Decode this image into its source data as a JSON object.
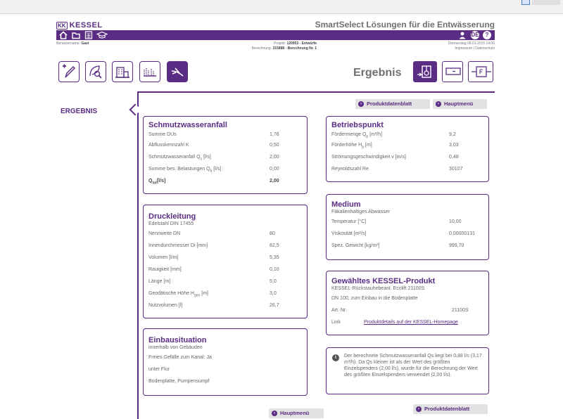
{
  "header": {
    "logo_mark": "KK",
    "logo_text": "KESSEL",
    "site_title": "SmartSelect Lösungen für die Entwässerung",
    "lang_badge": "DE",
    "help_badge": "?"
  },
  "meta": {
    "user_label": "Benutzername:",
    "user_name": "Gast",
    "project_label": "Projekt:",
    "project_value": "120953 - Entwürfe",
    "calc_label": "Berechnung:",
    "calc_value": "315888 - Berechnung Nr. 1",
    "date": "Donnerstag 08.01.2015 14:00",
    "impressum": "Impressum",
    "sep": "|",
    "datenschutz": "Datenschutz"
  },
  "page": {
    "title": "Ergebnis",
    "sidebar_label": "ERGEBNIS"
  },
  "buttons": {
    "produktdatenblatt": "Produktdatenblatt",
    "hauptmenu": "Hauptmenü"
  },
  "schmutzwasser": {
    "title": "Schmutzwasseranfall",
    "rows": [
      {
        "label": "Summe DUs",
        "value": "1,76"
      },
      {
        "label": "Abflusskennzahl K",
        "value": "0,50"
      },
      {
        "label": "Schmutzwasseranfall Q",
        "sub": "s",
        "unit": " [l/s]",
        "value": "2,00"
      },
      {
        "label": "Summe bes. Belastungen Q",
        "sub": "b",
        "unit": " [l/s]",
        "value": "0,00"
      },
      {
        "label": "Q",
        "sub": "tot",
        "unit": "[l/s]",
        "value": "2,00"
      }
    ]
  },
  "druckleitung": {
    "title": "Druckleitung",
    "subtitle": "Edelstahl DIN 17455",
    "rows": [
      {
        "label": "Nennweite DN",
        "value": "80"
      },
      {
        "label": "Innendurchmesser Di [mm]",
        "value": "82,5"
      },
      {
        "label": "Volumen [l/m]",
        "value": "5,35"
      },
      {
        "label": "Rauigkeit [mm]",
        "value": "0,10"
      },
      {
        "label": "Länge [m]",
        "value": "5,0"
      },
      {
        "label": "Geodätische Höhe H",
        "sub": "geo",
        "unit": " [m]",
        "value": "3,0"
      },
      {
        "label": "Nutzvolumen [l]",
        "value": "26,7"
      }
    ]
  },
  "einbau": {
    "title": "Einbausituation",
    "subtitle": "innerhalb von Gebäuden",
    "lines": [
      "Freies Gefälle zum Kanal: Ja",
      "unter Flur",
      "Bodenplatte, Pumpensumpf"
    ]
  },
  "betriebspunkt": {
    "title": "Betriebspunkt",
    "rows": [
      {
        "label": "Fördermenge Q",
        "sub": "p",
        "unit": " [m³/h]",
        "value": "9,2"
      },
      {
        "label": "Förderhöhe H",
        "sub": "p",
        "unit": " [m]",
        "value": "3,03"
      },
      {
        "label": "Strömungsgeschwindigkeit v [m/s]",
        "value": "0,48"
      },
      {
        "label": "Reynoldszahl Re",
        "value": "30107"
      }
    ]
  },
  "medium": {
    "title": "Medium",
    "subtitle": "Fäkalienhaltiges Abwasser",
    "rows": [
      {
        "label": "Temperatur [°C]",
        "value": "10,00"
      },
      {
        "label": "Viskosität [m²/s]",
        "value": "0,00000131"
      },
      {
        "label": "Spez. Gewicht [kg/m³]",
        "value": "999,70"
      }
    ]
  },
  "produkt": {
    "title": "Gewähltes KESSEL-Produkt",
    "subtitle": "KESSEL-Rückstauhebeanl. Ecolift 21100S",
    "line": "DN 100, zum Einbau in die Bodenplatte",
    "art_label": "Art. Nr.",
    "art_value": "21100S",
    "link_label": "Link",
    "link_text": "Produktdetails auf der KESSEL-Homepage"
  },
  "info": {
    "icon": "i",
    "text": "Der berechnete Schmutzwasseranfall Qs liegt bei 0,88 l/s (3,17 m³/h). Da Qs kleiner ist als der Wert des größten Einzelspenders (2,00 l/s), wurde für die Berechnung der Wert des größten Einzelspenders verwendet (2,00 l/s)."
  },
  "icons": {
    "home": "home-icon",
    "folder": "folder-icon",
    "calculator": "calculator-icon",
    "education": "graduation-cap-icon",
    "user": "user-icon",
    "accent_color": "#5a2c83"
  }
}
